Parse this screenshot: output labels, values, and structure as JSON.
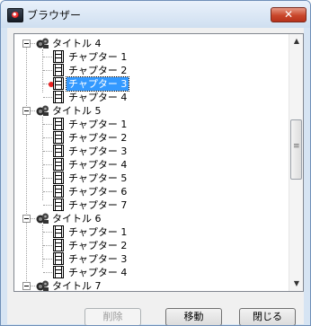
{
  "window": {
    "title": "ブラウザー",
    "close_icon": "close-icon",
    "close_glyph": "✕"
  },
  "tree": {
    "titles": [
      {
        "label": "タイトル 4",
        "chapters": [
          "チャプター 1",
          "チャプター 2",
          "チャプター 3",
          "チャプター 4"
        ],
        "selected": "チャプター 3"
      },
      {
        "label": "タイトル 5",
        "chapters": [
          "チャプター 1",
          "チャプター 2",
          "チャプター 3",
          "チャプター 4",
          "チャプター 5",
          "チャプター 6",
          "チャプター 7"
        ]
      },
      {
        "label": "タイトル 6",
        "chapters": [
          "チャプター 1",
          "チャプター 2",
          "チャプター 3",
          "チャプター 4"
        ]
      },
      {
        "label": "タイトル 7",
        "chapters": []
      }
    ]
  },
  "scrollbar": {
    "up_glyph": "▲",
    "down_glyph": "▼"
  },
  "buttons": {
    "delete": "削除",
    "move": "移動",
    "close": "閉じる"
  },
  "colors": {
    "selection": "#3399ff",
    "marker": "#e82020"
  }
}
